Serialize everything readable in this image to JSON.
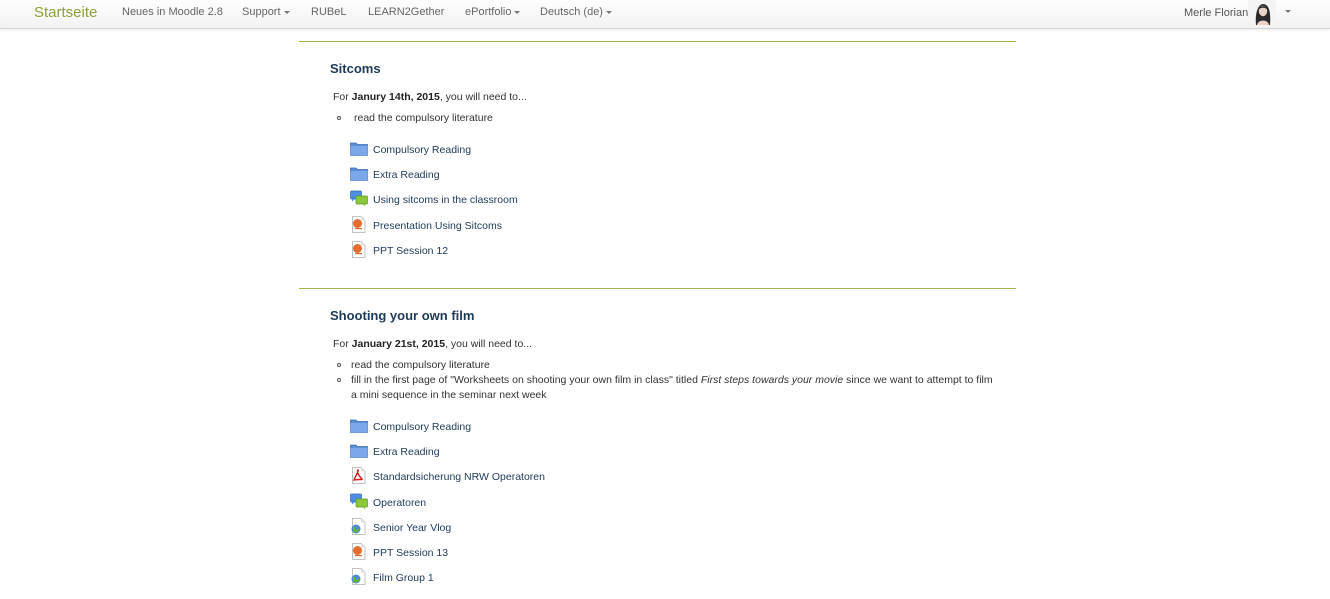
{
  "navbar": {
    "brand": "Startseite",
    "items": [
      {
        "label": "Neues in Moodle 2.8",
        "dropdown": false
      },
      {
        "label": "Support",
        "dropdown": true
      },
      {
        "label": "RUBeL",
        "dropdown": false
      },
      {
        "label": "LEARN2Gether",
        "dropdown": false
      },
      {
        "label": "ePortfolio",
        "dropdown": true
      },
      {
        "label": "Deutsch (de)",
        "dropdown": true
      }
    ],
    "user_name": "Merle Florian"
  },
  "sections": [
    {
      "title": "Sitcoms",
      "summary_prefix": "For ",
      "summary_date": "Janury 14th, 2015",
      "summary_suffix": ", you will need to...",
      "bullets": [
        {
          "text": "read the compulsory literature"
        }
      ],
      "activities": [
        {
          "icon": "folder-icon",
          "label": "Compulsory Reading"
        },
        {
          "icon": "folder-icon",
          "label": "Extra Reading"
        },
        {
          "icon": "forum-icon",
          "label": "Using sitcoms in the classroom"
        },
        {
          "icon": "powerpoint-icon",
          "label": "Presentation Using Sitcoms"
        },
        {
          "icon": "powerpoint-icon",
          "label": "PPT Session 12"
        }
      ]
    },
    {
      "title": "Shooting your own film",
      "summary_prefix": "For ",
      "summary_date": "January 21st, 2015",
      "summary_suffix": ", you will need to...",
      "bullets": [
        {
          "text": "read the compulsory literature"
        },
        {
          "before": "fill in the first page of \"Worksheets on shooting your own film in class\" titled ",
          "italic": "First steps towards your movie",
          "after": " since we want to attempt to film a mini sequence in the seminar next week"
        }
      ],
      "activities": [
        {
          "icon": "folder-icon",
          "label": "Compulsory Reading"
        },
        {
          "icon": "folder-icon",
          "label": "Extra Reading"
        },
        {
          "icon": "pdf-icon",
          "label": "Standardsicherung NRW Operatoren"
        },
        {
          "icon": "forum-icon",
          "label": "Operatoren"
        },
        {
          "icon": "url-icon",
          "label": "Senior Year Vlog"
        },
        {
          "icon": "powerpoint-icon",
          "label": "PPT Session 13"
        },
        {
          "icon": "url-icon",
          "label": "Film Group 1"
        }
      ]
    }
  ],
  "colors": {
    "brand": "#8aa23a",
    "link": "#1d3a58",
    "divider": "#a3b54a"
  }
}
